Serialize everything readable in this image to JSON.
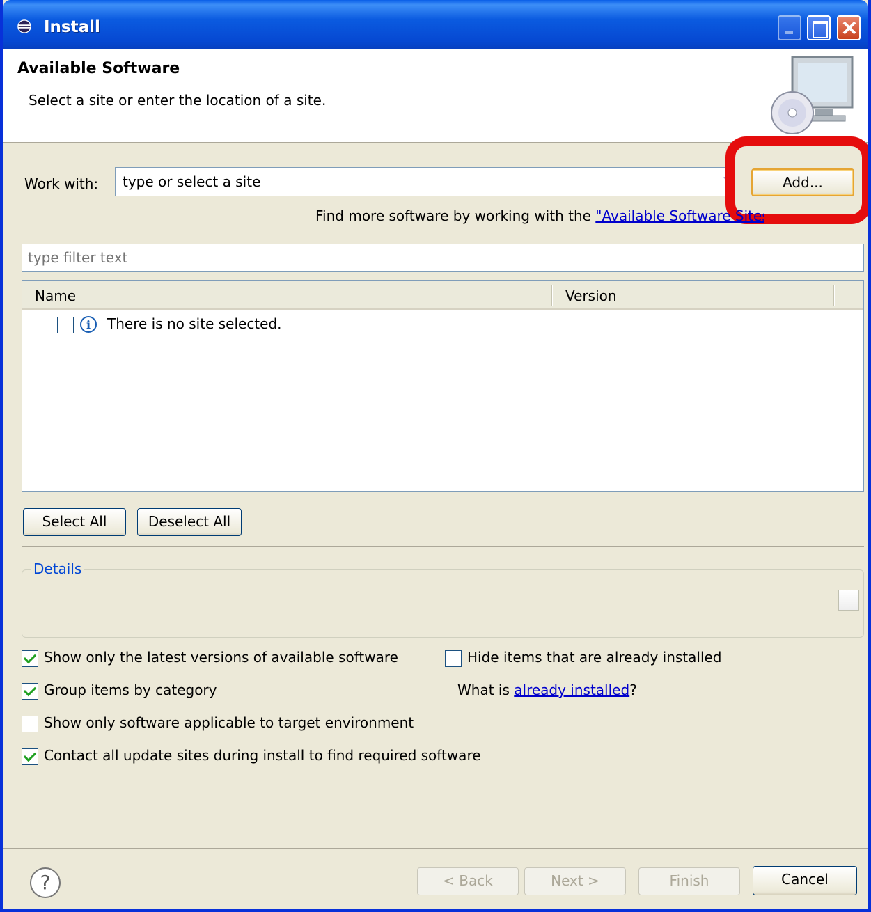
{
  "window": {
    "title": "Install"
  },
  "header": {
    "title": "Available Software",
    "description": "Select a site or enter the location of a site."
  },
  "work_with": {
    "label": "Work with:",
    "value": "type or select a site",
    "add_label": "Add...",
    "find_more_prefix": "Find more software by working with the ",
    "find_more_link": "\"Available Software Sites\""
  },
  "filter": {
    "placeholder": "type filter text"
  },
  "table": {
    "columns": [
      "Name",
      "Version"
    ],
    "rows": [
      {
        "name": "There is no site selected.",
        "checked": false
      }
    ]
  },
  "selection": {
    "select_all": "Select All",
    "deselect_all": "Deselect All"
  },
  "details": {
    "title": "Details"
  },
  "options": {
    "show_latest": {
      "label": "Show only the latest versions of available software",
      "checked": true
    },
    "group_by_category": {
      "label": "Group items by category",
      "checked": true
    },
    "show_applicable": {
      "label": "Show only software applicable to target environment",
      "checked": false
    },
    "contact_sites": {
      "label": "Contact all update sites during install to find required software",
      "checked": true
    },
    "hide_installed": {
      "label": "Hide items that are already installed",
      "checked": false
    },
    "what_is_prefix": "What is ",
    "what_is_link": "already installed",
    "what_is_suffix": "?"
  },
  "footer": {
    "back": "< Back",
    "next": "Next >",
    "finish": "Finish",
    "cancel": "Cancel"
  },
  "colors": {
    "annotation_ring": "#e50d0d",
    "titlebar": "#0648d2",
    "link": "#0000cc"
  }
}
